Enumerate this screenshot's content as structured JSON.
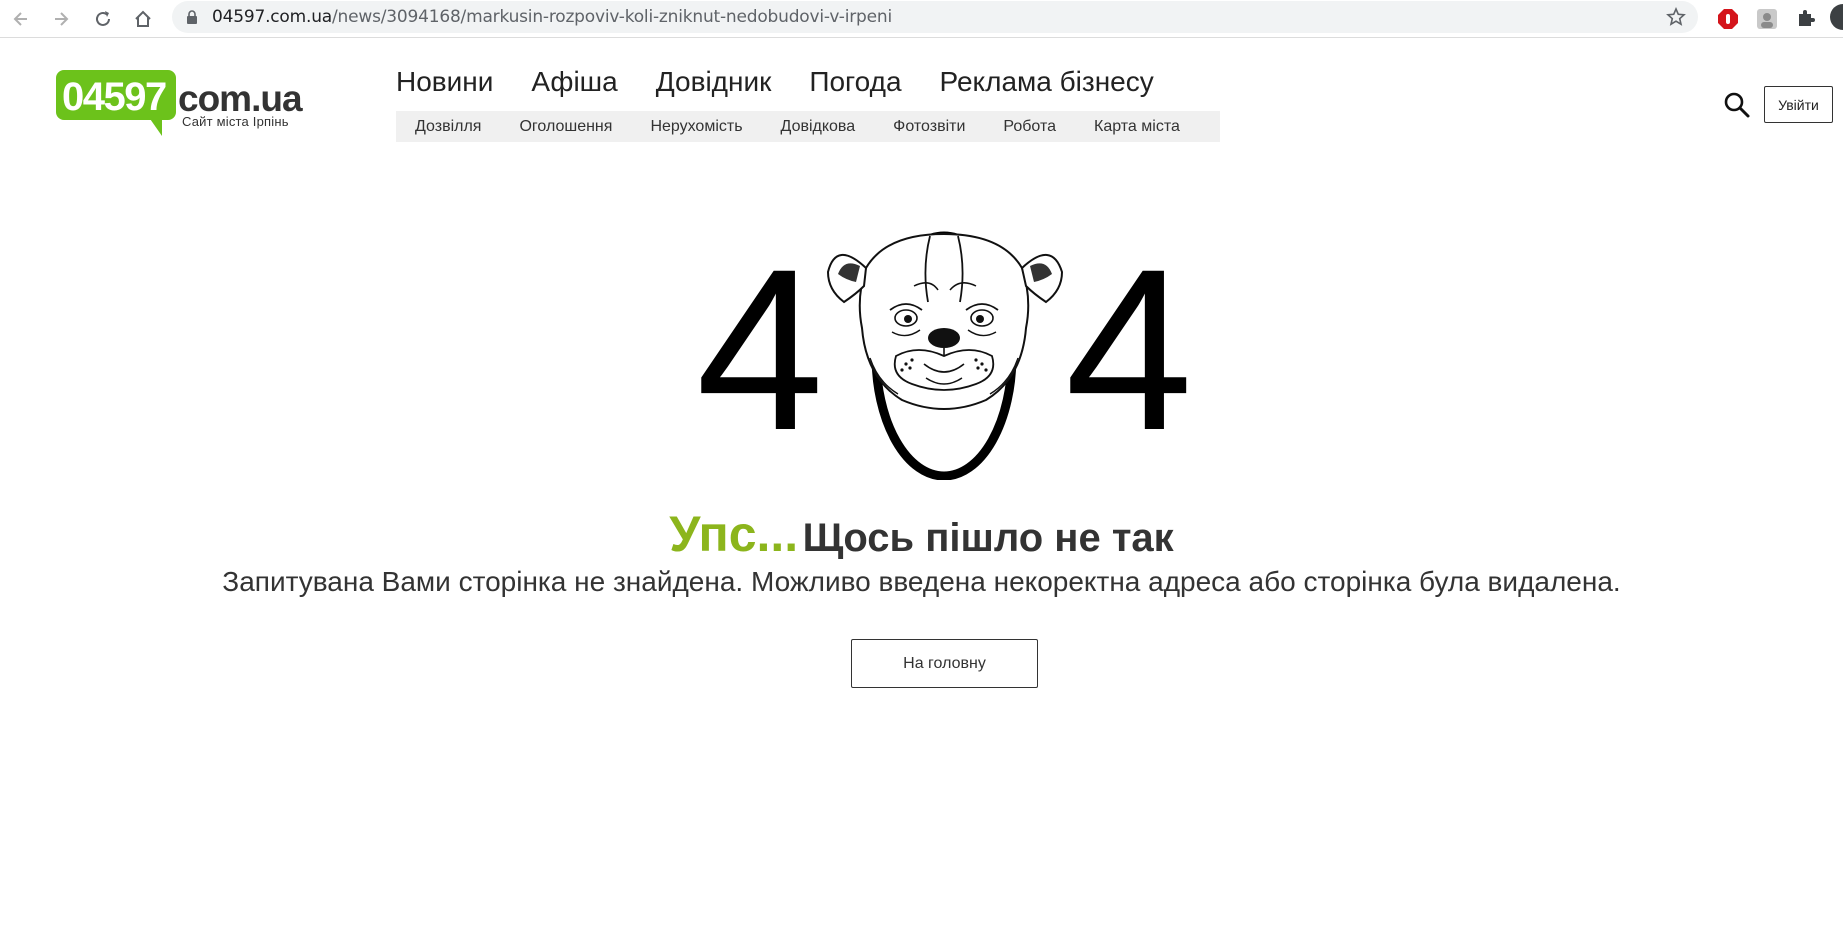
{
  "browser": {
    "url_domain": "04597.com.ua",
    "url_path": "/news/3094168/markusin-rozpoviv-koli-zniknut-nedobudovi-v-irpeni",
    "icons": [
      "back-icon",
      "forward-icon",
      "reload-icon",
      "home-icon",
      "lock-icon",
      "star-icon",
      "adblock-icon",
      "profile-extension-icon",
      "puzzle-icon"
    ]
  },
  "header": {
    "logo_number": "04597",
    "logo_domain": "com.ua",
    "logo_tagline": "Сайт міста Ірпінь",
    "main_nav": [
      "Новини",
      "Афіша",
      "Довідник",
      "Погода",
      "Реклама бізнесу"
    ],
    "sub_nav": [
      "Дозвілля",
      "Оголошення",
      "Нерухомість",
      "Довідкова",
      "Фотозвіти",
      "Робота",
      "Карта міста"
    ],
    "login_label": "Увійти"
  },
  "error": {
    "digit_left": "4",
    "digit_right": "4",
    "oops": "Упс...",
    "headline": "Щось пішло не так",
    "message": "Запитувана Вами сторінка не знайдена. Можливо введена некоректна адреса або сторінка була видалена.",
    "home_button": "На головну"
  },
  "colors": {
    "brand_green": "#6cc21b",
    "oops_green": "#8cb51c",
    "text_dark": "#333333"
  }
}
